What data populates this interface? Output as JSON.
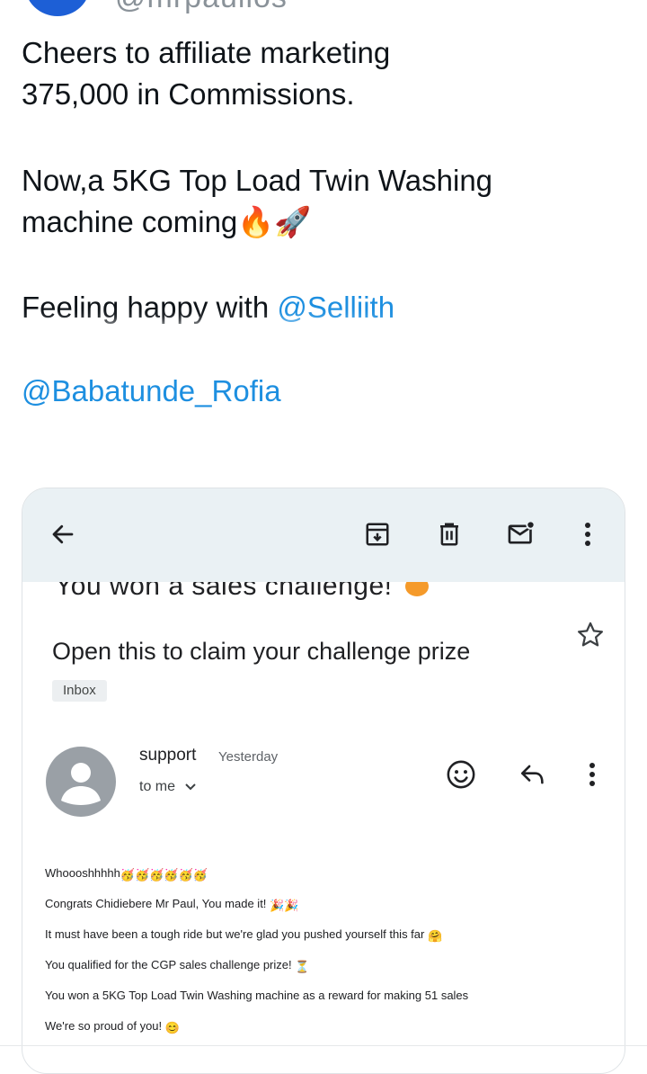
{
  "tweet": {
    "handle": "@mrpaulios",
    "line1": "Cheers to affiliate marketing",
    "line2": "375,000 in Commissions.",
    "line3": "Now,a 5KG Top Load Twin Washing",
    "line4": "machine coming",
    "line4_emojis": "🔥🚀",
    "line5": "Feeling happy with ",
    "mention1": "@Selliith",
    "mention2": "@Babatunde_Rofia"
  },
  "email": {
    "cut_subject": "You won a sales challenge!",
    "subject": "Open this to claim your challenge prize",
    "label": "Inbox",
    "sender": "support",
    "time": "Yesterday",
    "recipient": "to me",
    "body": [
      {
        "text": "Whoooshhhhh",
        "emoji": "🥳🥳🥳🥳🥳🥳"
      },
      {
        "text": "Congrats Chidiebere Mr Paul, You made it! ",
        "emoji": "🎉🎉"
      },
      {
        "text": "It must have been a tough ride but we're glad you pushed yourself this far ",
        "emoji": "🤗"
      },
      {
        "text": "You qualified for the CGP sales challenge prize! ",
        "emoji": "⏳"
      },
      {
        "text": "You won a 5KG Top Load Twin Washing machine as a reward for making 51 sales",
        "emoji": ""
      },
      {
        "text": "We're so proud of you! ",
        "emoji": "😊"
      }
    ]
  },
  "icons": [
    "back-arrow-icon",
    "archive-icon",
    "delete-icon",
    "mark-unread-icon",
    "more-vert-icon",
    "star-icon",
    "person-icon",
    "emoji-reaction-icon",
    "reply-icon",
    "chevron-down-icon"
  ],
  "colors": {
    "mention": "#1d8fe0",
    "toolbar_bg": "#eaf1f4",
    "avatar_gray": "#9aa0a6"
  }
}
